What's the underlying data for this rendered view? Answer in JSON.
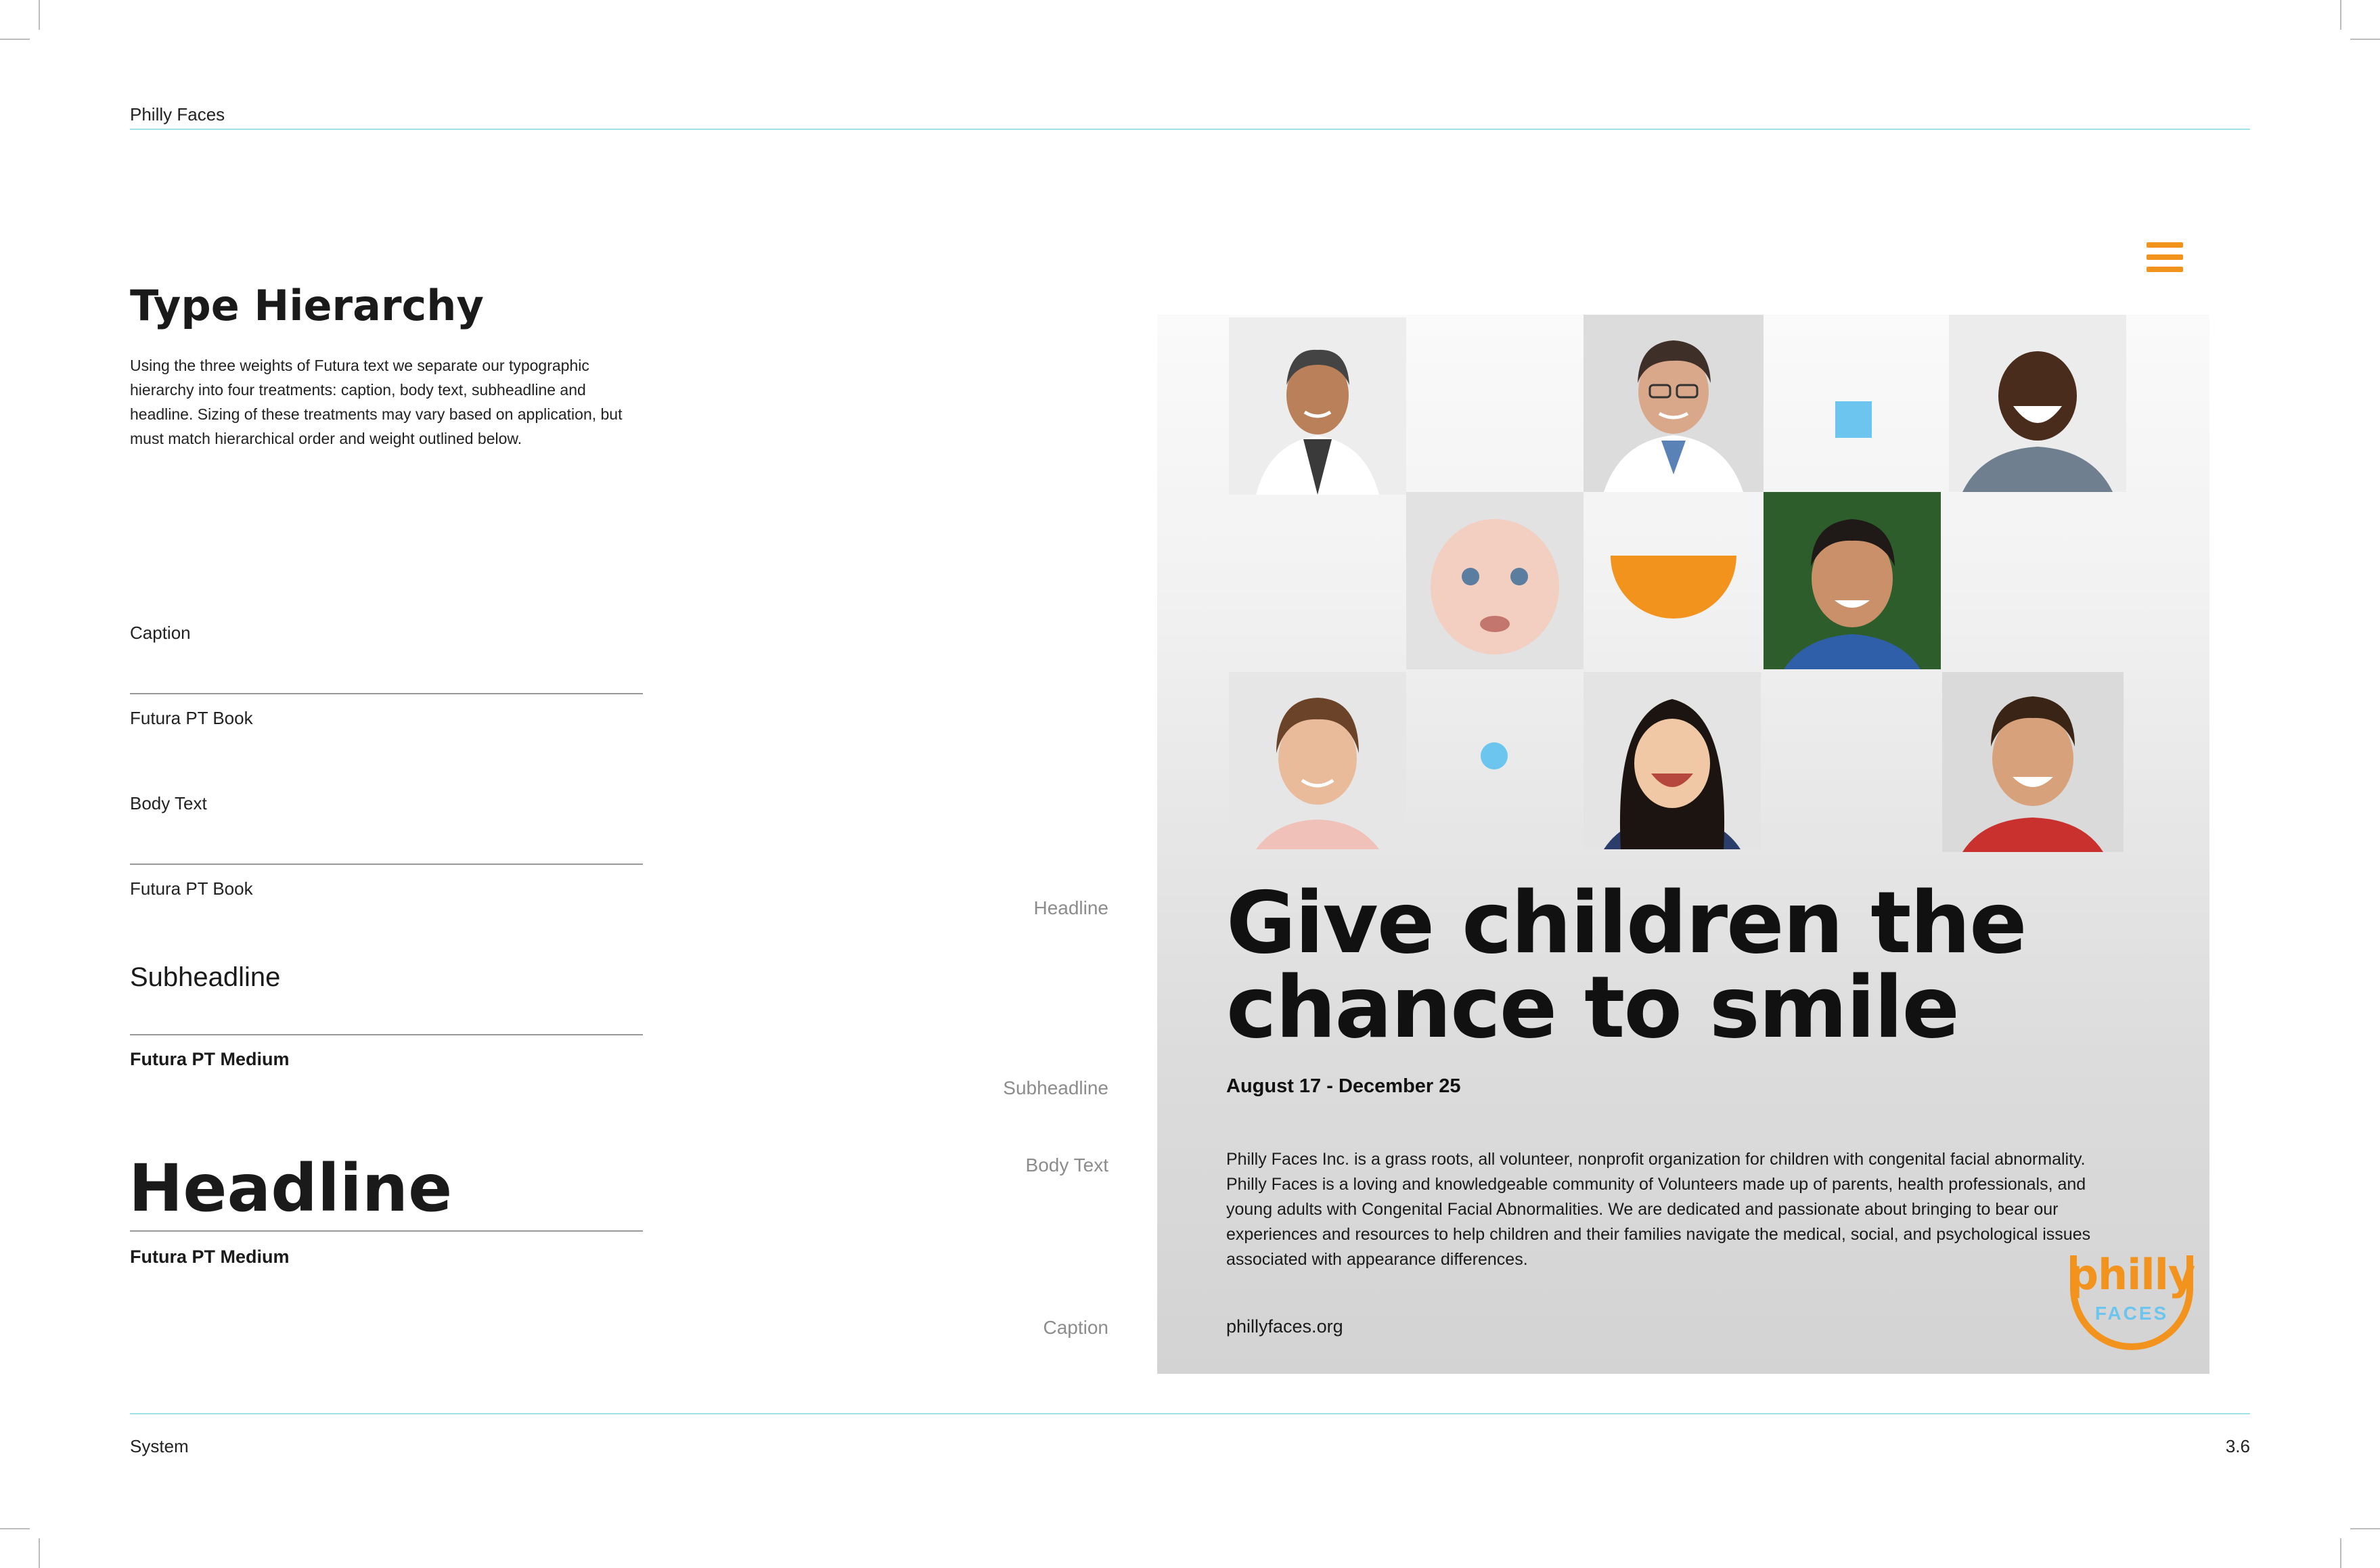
{
  "header": {
    "brand": "Philly Faces"
  },
  "section": {
    "title": "Type Hierarchy",
    "intro": "Using the three weights of Futura text we separate our typographic hierarchy into four treatments: caption, body text, subheadline and headline. Sizing of these treatments may vary based on application, but must match hierarchical order and weight outlined below."
  },
  "specimens": {
    "caption_sample": "Caption",
    "caption_font": "Futura PT Book",
    "body_sample": "Body Text",
    "body_font": "Futura PT Book",
    "subheadline_sample": "Subheadline",
    "subheadline_font": "Futura PT Medium",
    "headline_sample": "Headline",
    "headline_font": "Futura PT Medium"
  },
  "poster_labels": {
    "headline": "Headline",
    "subheadline": "Subheadline",
    "body": "Body Text",
    "caption": "Caption"
  },
  "poster": {
    "headline": "Give children the chance to smile",
    "subheadline": "August 17 - December 25",
    "body": "Philly Faces Inc. is a grass roots, all volunteer, nonprofit organization for children with congenital facial abnormality. Philly Faces is a loving and knowledgeable community of Volunteers made up of parents, health professionals, and young adults with Congenital Facial Abnormalities. We are dedicated and passionate about bringing to bear our experiences and resources to help children and their families navigate the medical, social, and psychological issues associated with appearance differences.",
    "caption": "phillyfaces.org",
    "logo_top": "philly",
    "logo_bottom": "FACES"
  },
  "footer": {
    "left": "System",
    "page_number": "3.6"
  },
  "colors": {
    "accent_orange": "#f2931e",
    "accent_blue": "#6cc5ee",
    "rule_teal": "#9fe3e6"
  },
  "icons": [
    "menu-icon"
  ]
}
